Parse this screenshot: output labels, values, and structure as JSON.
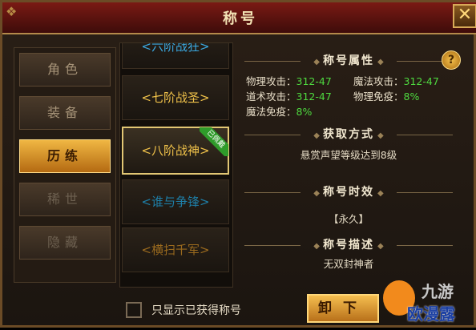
{
  "window": {
    "title": "称号",
    "close_label": "✕"
  },
  "sidebar": {
    "items": [
      {
        "label": "角色"
      },
      {
        "label": "装备"
      },
      {
        "label": "历练"
      },
      {
        "label": "稀世"
      },
      {
        "label": "隐藏"
      }
    ],
    "active_index": 2
  },
  "titles": {
    "items": [
      {
        "label": "<六阶战狂>",
        "color": "#3aa8e0"
      },
      {
        "label": "<七阶战圣>",
        "color": "#f0c24a"
      },
      {
        "label": "<八阶战神>",
        "color": "#f0c24a",
        "badge": "已佩戴"
      },
      {
        "label": "<谁与争锋>",
        "color": "#1e7fa8"
      },
      {
        "label": "<横扫千军>",
        "color": "#9a6a1e"
      }
    ],
    "selected_index": 2
  },
  "details": {
    "attr_heading": "称号属性",
    "help_label": "?",
    "attributes": [
      {
        "name": "物理攻击：",
        "value": "312-47"
      },
      {
        "name": "魔法攻击：",
        "value": "312-47"
      },
      {
        "name": "道术攻击：",
        "value": "312-47"
      },
      {
        "name": "物理免疫：",
        "value": "8%"
      },
      {
        "name": "魔法免疫：",
        "value": "8%"
      }
    ],
    "source_heading": "获取方式",
    "source_text": "悬赏声望等级达到8级",
    "duration_heading": "称号时效",
    "duration_text": "【永久】",
    "desc_heading": "称号描述",
    "desc_text": "无双封神者"
  },
  "footer": {
    "checkbox_label": "只显示已获得称号",
    "unload_label": "卸下"
  },
  "watermark": {
    "line1": "九游",
    "line2": "欧漫露"
  }
}
